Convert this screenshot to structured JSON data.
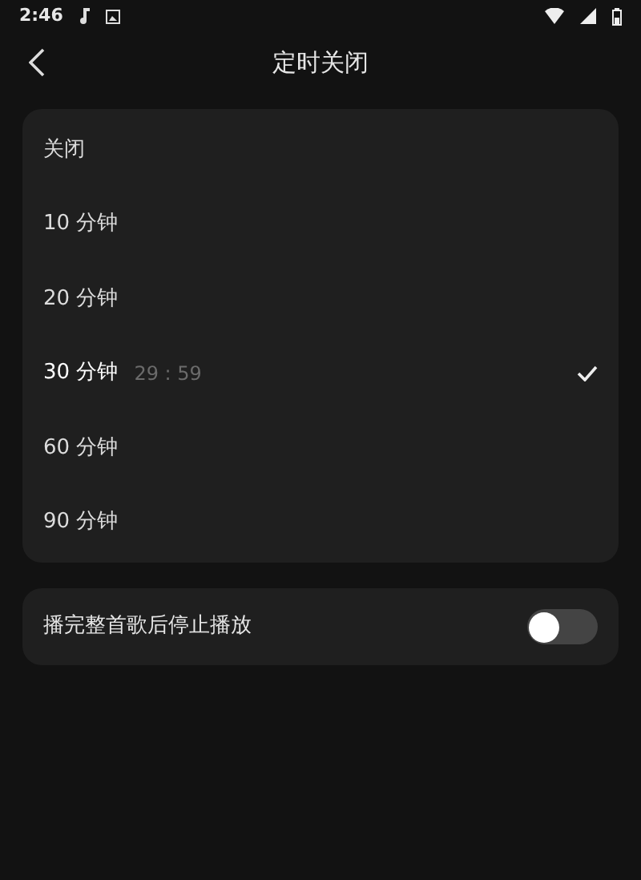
{
  "status_bar": {
    "time": "2:46"
  },
  "header": {
    "title": "定时关闭"
  },
  "options": [
    {
      "label": "关闭",
      "selected": false
    },
    {
      "label": "10 分钟",
      "selected": false
    },
    {
      "label": "20 分钟",
      "selected": false
    },
    {
      "label": "30 分钟",
      "selected": true,
      "remaining": "29 : 59"
    },
    {
      "label": "60 分钟",
      "selected": false
    },
    {
      "label": "90 分钟",
      "selected": false
    }
  ],
  "finish_song": {
    "label": "播完整首歌后停止播放",
    "on": false
  }
}
